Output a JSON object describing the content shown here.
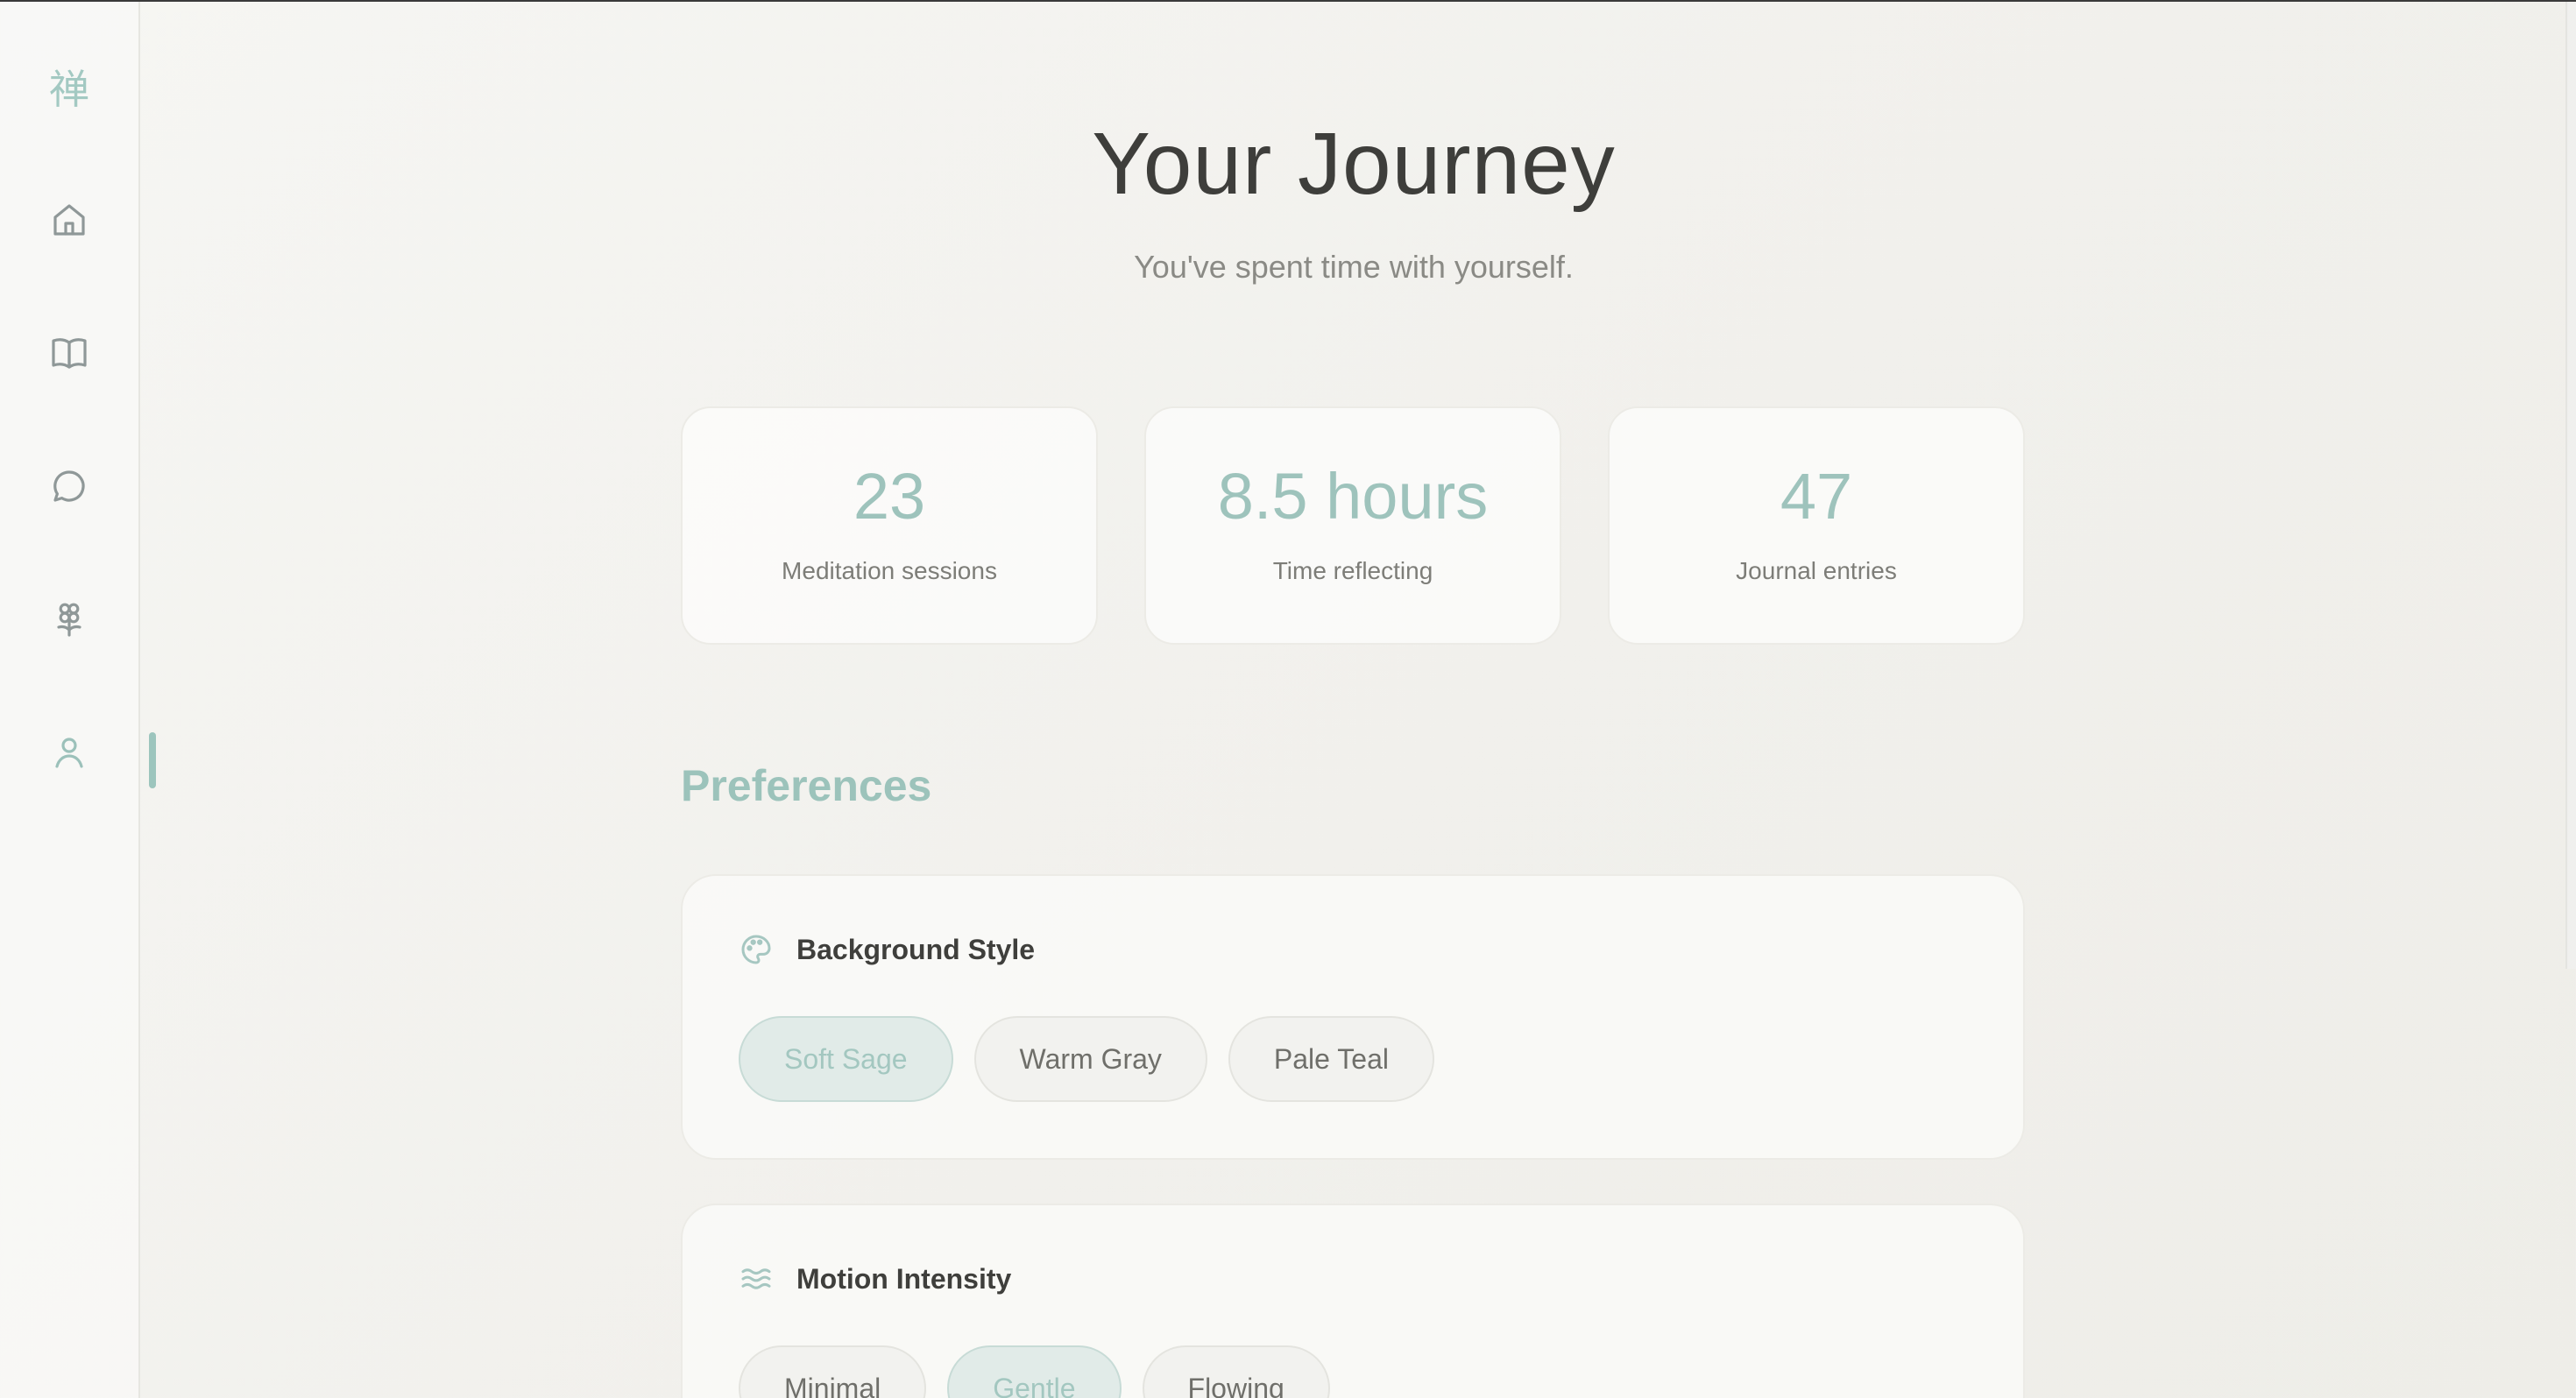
{
  "sidebar": {
    "logo": "禅",
    "nav": [
      {
        "name": "home",
        "icon": "home-icon"
      },
      {
        "name": "journal",
        "icon": "book-icon"
      },
      {
        "name": "chat",
        "icon": "chat-bubble-icon"
      },
      {
        "name": "meditate",
        "icon": "flower-icon"
      },
      {
        "name": "profile",
        "icon": "user-icon",
        "active": true
      }
    ]
  },
  "header": {
    "title": "Your Journey",
    "subtitle": "You've spent time with yourself."
  },
  "stats": [
    {
      "value": "23",
      "label": "Meditation sessions"
    },
    {
      "value": "8.5 hours",
      "label": "Time reflecting"
    },
    {
      "value": "47",
      "label": "Journal entries"
    }
  ],
  "preferences": {
    "title": "Preferences",
    "background_style": {
      "icon": "palette-icon",
      "title": "Background Style",
      "options": [
        "Soft Sage",
        "Warm Gray",
        "Pale Teal"
      ],
      "selected": "Soft Sage"
    },
    "motion_intensity": {
      "icon": "waves-icon",
      "title": "Motion Intensity",
      "options": [
        "Minimal",
        "Gentle",
        "Flowing"
      ],
      "selected": "Gentle"
    }
  },
  "colors": {
    "accent": "#9ec3bc",
    "text": "#3e3e3b",
    "muted": "#8a8a85"
  }
}
